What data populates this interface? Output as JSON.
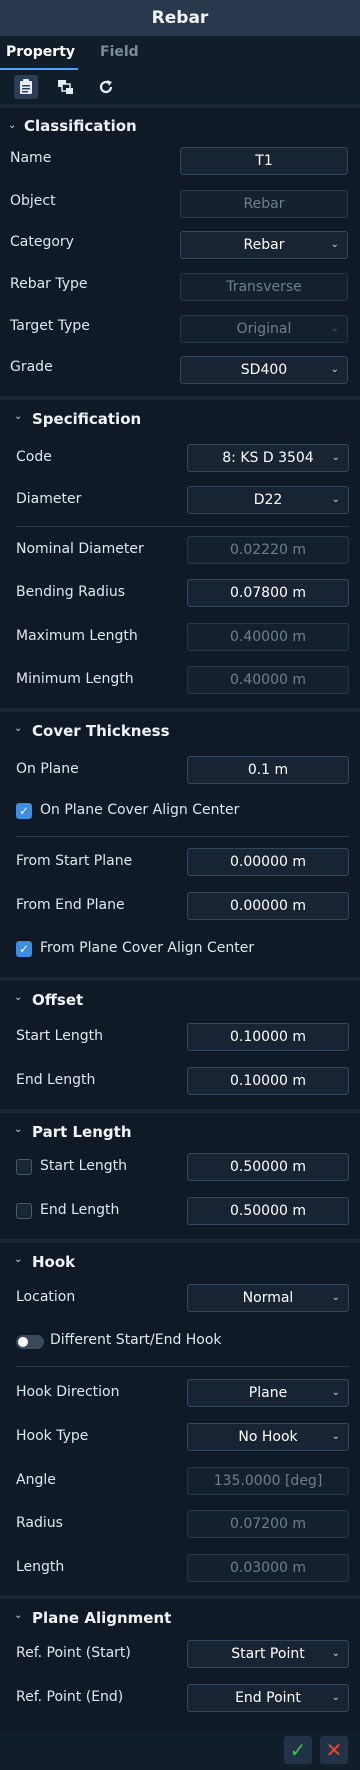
{
  "title": "Rebar",
  "tabs": [
    "Property",
    "Field"
  ],
  "toolbar": {
    "icons": [
      "clipboard-icon",
      "copy-layers-icon",
      "refresh-icon"
    ]
  },
  "classification": {
    "title": "Classification",
    "name_label": "Name",
    "name_value": "T1",
    "object_label": "Object",
    "object_value": "Rebar",
    "category_label": "Category",
    "category_value": "Rebar",
    "rebar_type_label": "Rebar Type",
    "rebar_type_value": "Transverse",
    "target_type_label": "Target Type",
    "target_type_value": "Original",
    "grade_label": "Grade",
    "grade_value": "SD400"
  },
  "specification": {
    "title": "Specification",
    "code_label": "Code",
    "code_value": "8: KS D 3504",
    "diameter_label": "Diameter",
    "diameter_value": "D22",
    "nominal_label": "Nominal Diameter",
    "nominal_value": "0.02220 m",
    "bending_label": "Bending Radius",
    "bending_value": "0.07800 m",
    "max_label": "Maximum Length",
    "max_value": "0.40000 m",
    "min_label": "Minimum Length",
    "min_value": "0.40000 m"
  },
  "cover": {
    "title": "Cover Thickness",
    "on_plane_label": "On Plane",
    "on_plane_value": "0.1 m",
    "on_plane_align_label": "On Plane Cover Align Center",
    "from_start_label": "From Start Plane",
    "from_start_value": "0.00000 m",
    "from_end_label": "From End Plane",
    "from_end_value": "0.00000 m",
    "from_plane_align_label": "From Plane Cover Align Center"
  },
  "offset": {
    "title": "Offset",
    "start_label": "Start Length",
    "start_value": "0.10000 m",
    "end_label": "End Length",
    "end_value": "0.10000 m"
  },
  "part_length": {
    "title": "Part Length",
    "start_label": "Start Length",
    "start_value": "0.50000 m",
    "end_label": "End Length",
    "end_value": "0.50000 m"
  },
  "hook": {
    "title": "Hook",
    "location_label": "Location",
    "location_value": "Normal",
    "different_label": "Different Start/End Hook",
    "direction_label": "Hook Direction",
    "direction_value": "Plane",
    "type_label": "Hook Type",
    "type_value": "No Hook",
    "angle_label": "Angle",
    "angle_value": "135.0000 [deg]",
    "radius_label": "Radius",
    "radius_value": "0.07200 m",
    "length_label": "Length",
    "length_value": "0.03000 m"
  },
  "plane_alignment": {
    "title": "Plane Alignment",
    "ref_start_label": "Ref. Point (Start)",
    "ref_start_value": "Start Point",
    "ref_end_label": "Ref. Point (End)",
    "ref_end_value": "End Point"
  },
  "colors": {
    "accent": "#4aa3ff",
    "ok": "#3fc24a",
    "cancel": "#e8453c",
    "background": "#0f1a26"
  }
}
